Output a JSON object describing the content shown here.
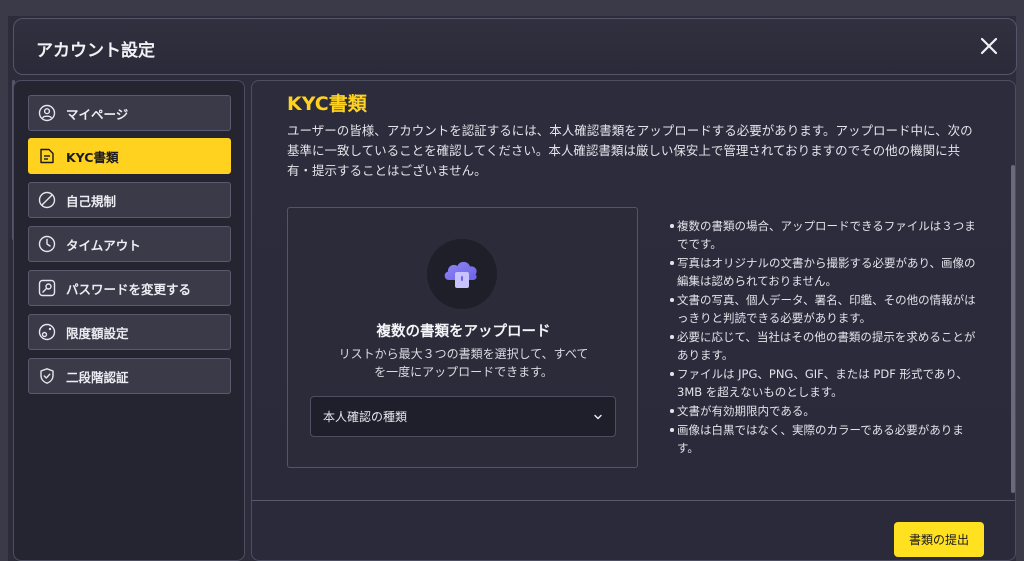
{
  "header": {
    "title": "アカウント設定"
  },
  "sidebar": {
    "items": [
      {
        "label": "マイページ",
        "icon": "user-icon",
        "active": false
      },
      {
        "label": "KYC書類",
        "icon": "document-icon",
        "active": true
      },
      {
        "label": "自己規制",
        "icon": "block-icon",
        "active": false
      },
      {
        "label": "タイムアウト",
        "icon": "clock-icon",
        "active": false
      },
      {
        "label": "パスワードを変更する",
        "icon": "key-icon",
        "active": false
      },
      {
        "label": "限度額設定",
        "icon": "limit-icon",
        "active": false
      },
      {
        "label": "二段階認証",
        "icon": "shield-icon",
        "active": false
      }
    ]
  },
  "main": {
    "title": "KYC書類",
    "description": "ユーザーの皆様、アカウントを認証するには、本人確認書類をアップロードする必要があります。アップロード中に、次の基準に一致していることを確認してください。本人確認書類は厳しい保安上で管理されておりますのでその他の機関に共有・提示することはございません。",
    "upload": {
      "title": "複数の書類をアップロード",
      "subtitle": "リストから最大３つの書類を選択して、すべてを一度にアップロードできます。",
      "select_label": "本人確認の種類"
    },
    "requirements": [
      "複数の書類の場合、アップロードできるファイルは３つまでです。",
      "写真はオリジナルの文書から撮影する必要があり、画像の編集は認められておりません。",
      "文書の写真、個人データ、署名、印鑑、その他の情報がはっきりと判読できる必要があります。",
      "必要に応じて、当社はその他の書類の提示を求めることがあります。",
      "ファイルは JPG、PNG、GIF、または PDF 形式であり、3MB を超えないものとします。",
      "文書が有効期限内である。",
      "画像は白黒ではなく、実際のカラーである必要があります。"
    ],
    "submit_label": "書類の提出"
  },
  "colors": {
    "accent": "#ffd21f",
    "background": "#2c2c3a",
    "panel": "#252532"
  }
}
